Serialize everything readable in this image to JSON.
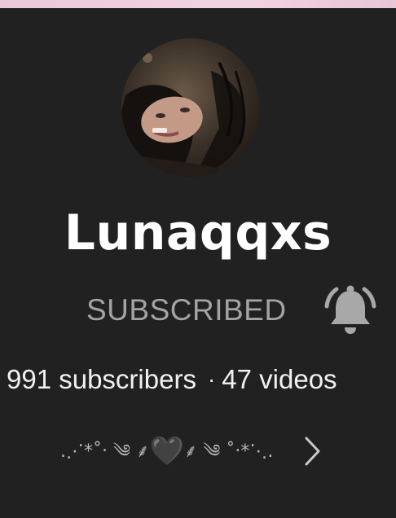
{
  "channel": {
    "name": "Lunaqqxs",
    "subscribe_label": "SUBSCRIBED",
    "subscribers": "991 subscribers",
    "separator": "·",
    "videos": "47 videos",
    "description_left": ".⋰*˚‧ ༄ ⸙",
    "description_heart": "🖤",
    "description_right": "⸙ ༄ ˚‧*⋱."
  },
  "icons": {
    "notification": "bell-icon",
    "expand": "chevron-right-icon",
    "avatar": "avatar-image"
  },
  "colors": {
    "background": "#212121",
    "text_primary": "#ffffff",
    "text_muted": "#a3a3a3",
    "top_strip": "#f0d3e2"
  }
}
